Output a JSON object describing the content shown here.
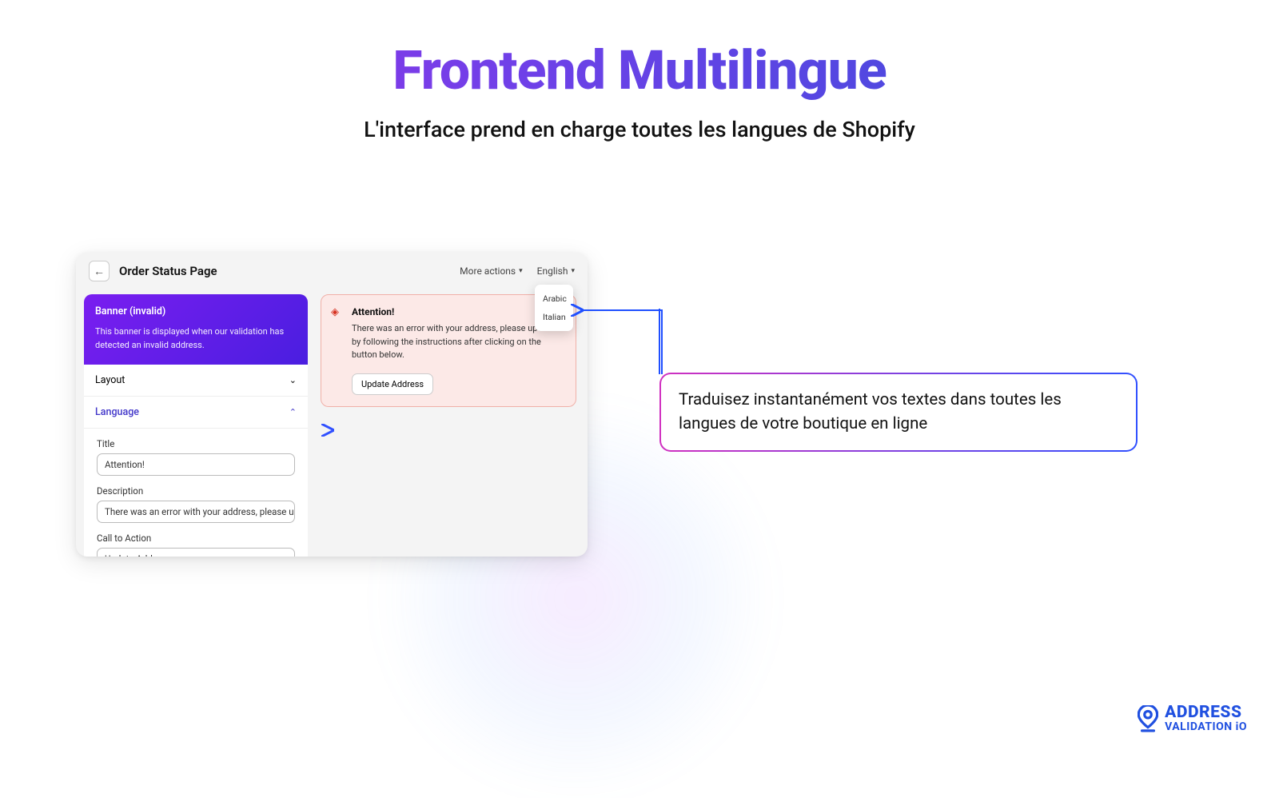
{
  "hero": {
    "title": "Frontend Multilingue",
    "subtitle": "L'interface prend en charge toutes les langues de Shopify"
  },
  "window": {
    "title": "Order Status Page",
    "more_actions": "More actions",
    "language_selector": "English",
    "dropdown": {
      "item1": "Arabic",
      "item2": "Italian"
    },
    "banner": {
      "heading": "Banner (invalid)",
      "description": "This banner is displayed when our validation has detected an invalid address."
    },
    "sections": {
      "layout": "Layout",
      "language": "Language"
    },
    "fields": {
      "title_label": "Title",
      "title_value": "Attention!",
      "description_label": "Description",
      "description_value": "There was an error with your address, please update it b",
      "cta_label": "Call to Action",
      "cta_value": "Update Address"
    },
    "alert": {
      "title": "Attention!",
      "body": "There was an error with your address, please update it by following the instructions after clicking on the button below.",
      "button": "Update Address"
    }
  },
  "callout": {
    "text": "Traduisez instantanément vos textes dans toutes les langues de votre boutique en ligne"
  },
  "brand": {
    "line1": "ADDRESS",
    "line2": "VALIDATION iO"
  }
}
